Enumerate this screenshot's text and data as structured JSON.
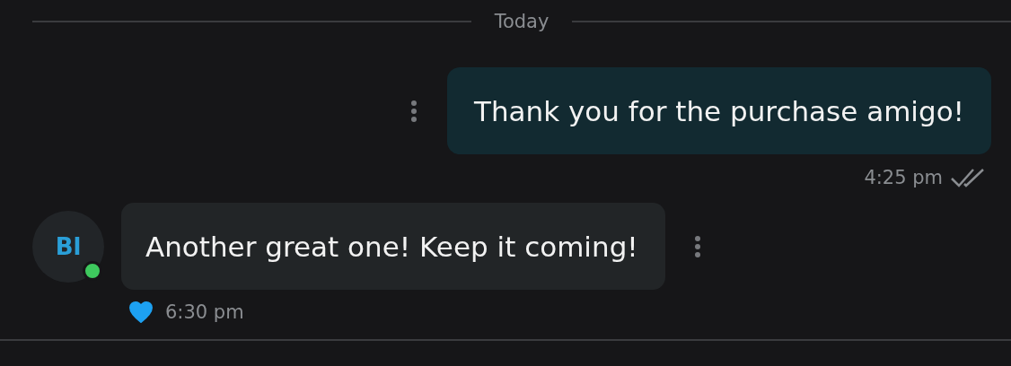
{
  "date_separator": "Today",
  "messages": [
    {
      "kind": "sent",
      "text": "Thank you for the purchase amigo!",
      "time": "4:25 pm",
      "read": true
    },
    {
      "kind": "received",
      "avatar_initials": "Bl",
      "online": true,
      "text": "Another great one! Keep it coming!",
      "time": "6:30 pm",
      "liked": true
    }
  ]
}
